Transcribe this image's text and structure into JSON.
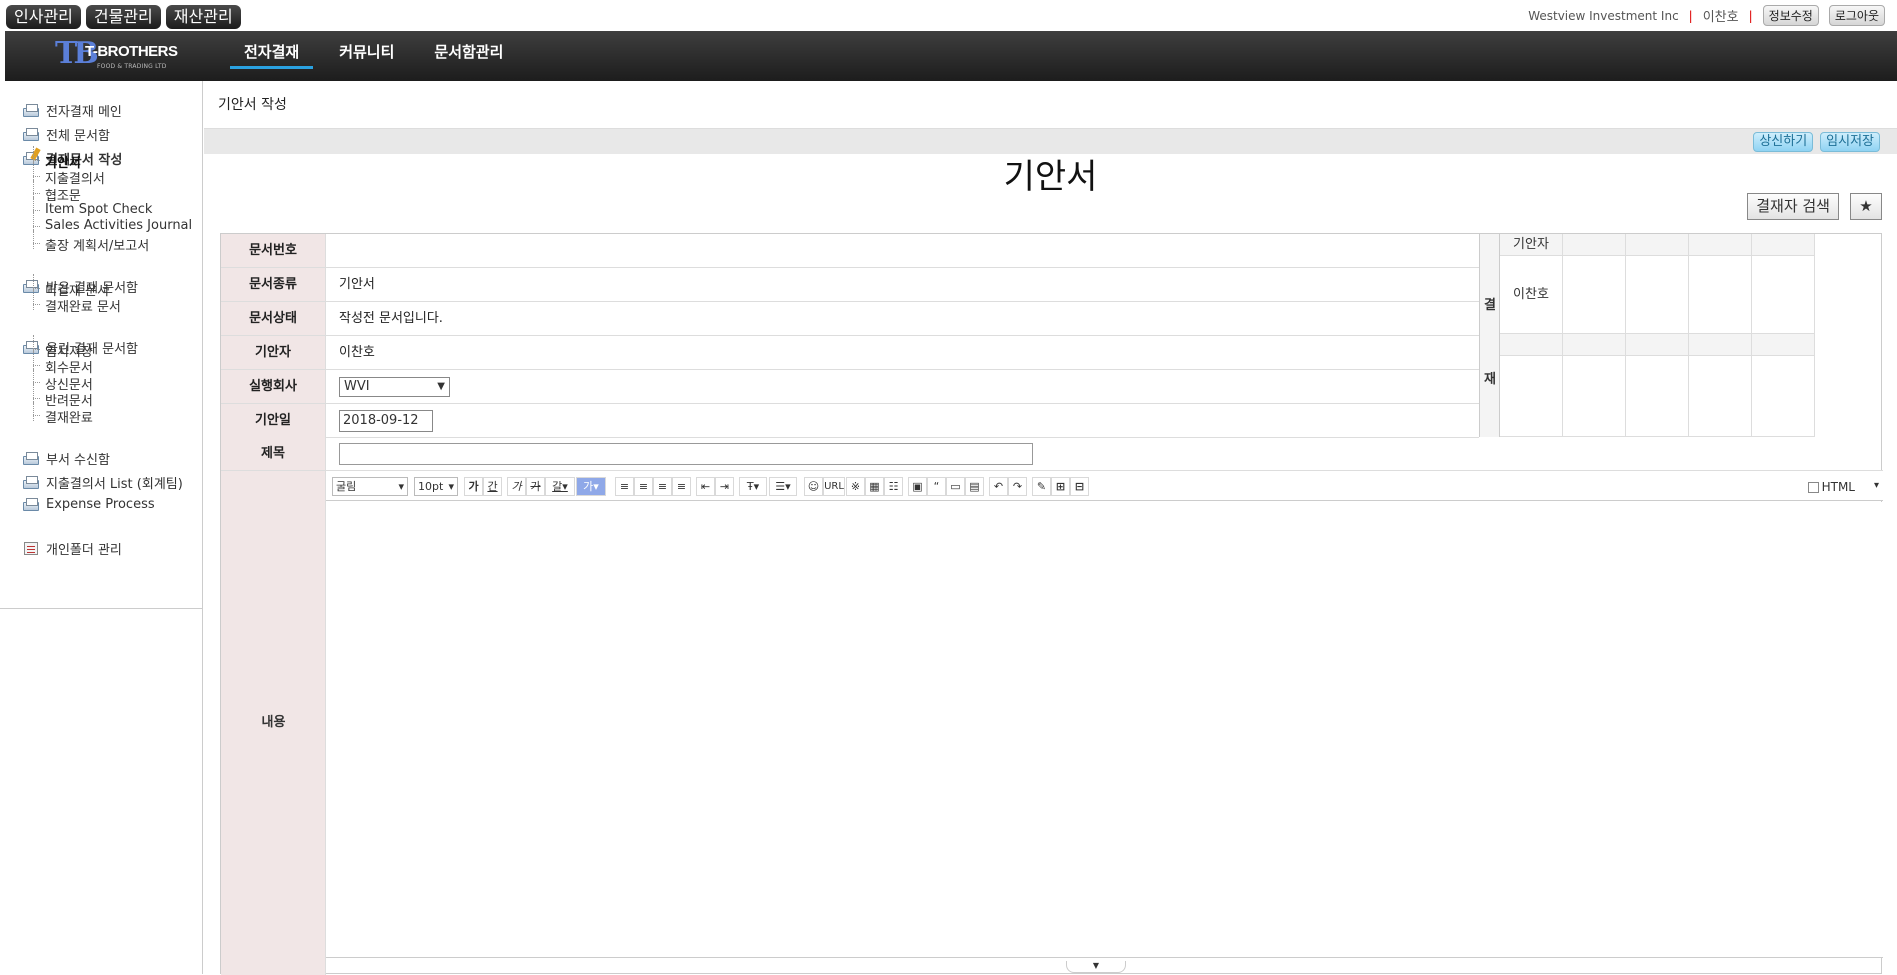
{
  "top": {
    "modules": [
      "인사관리",
      "건물관리",
      "재산관리"
    ],
    "company": "Westview Investment Inc",
    "user": "이찬호",
    "edit_info": "정보수정",
    "logout": "로그아웃"
  },
  "nav": {
    "logo_name": "T-BROTHERS",
    "logo_sub": "FOOD & TRADING LTD",
    "items": [
      "전자결재",
      "커뮤니티",
      "문서함관리"
    ]
  },
  "sidebar": {
    "main": "전자결재 메인",
    "all_box": "전체 문서함",
    "compose": "결재문서 작성",
    "compose_items": [
      "기안서",
      "지출결의서",
      "협조문",
      "Item Spot Check",
      "Sales Activities Journal",
      "출장 계획서/보고서"
    ],
    "received": "받은 결재 문서함",
    "received_items": [
      "미결재 문서",
      "결재완료 문서"
    ],
    "sent": "올린 결재 문서함",
    "sent_items": [
      "임시저장",
      "회수문서",
      "상신문서",
      "반려문서",
      "결재완료"
    ],
    "dept": "부서 수신함",
    "expense_list": "지출결의서 List (회계팀)",
    "expense_process": "Expense Process",
    "personal": "개인폴더 관리"
  },
  "main": {
    "page_title": "기안서 작성",
    "submit": "상신하기",
    "save_draft": "임시저장",
    "doc_title": "기안서",
    "search_approver": "결재자 검색",
    "star": "★"
  },
  "form": {
    "labels": {
      "doc_no": "문서번호",
      "doc_type": "문서종류",
      "doc_status": "문서상태",
      "drafter": "기안자",
      "company": "실행회사",
      "draft_date": "기안일",
      "subject": "제목",
      "content": "내용"
    },
    "values": {
      "doc_no": "",
      "doc_type": "기안서",
      "doc_status": "작성전 문서입니다.",
      "drafter": "이찬호",
      "company": "WVI",
      "draft_date": "2018-09-12"
    }
  },
  "approval": {
    "side_top": "결",
    "side_bottom": "재",
    "header": "기안자",
    "approver": "이찬호"
  },
  "editor": {
    "font": "굴림",
    "size": "10pt",
    "url": "URL",
    "html": "HTML"
  }
}
